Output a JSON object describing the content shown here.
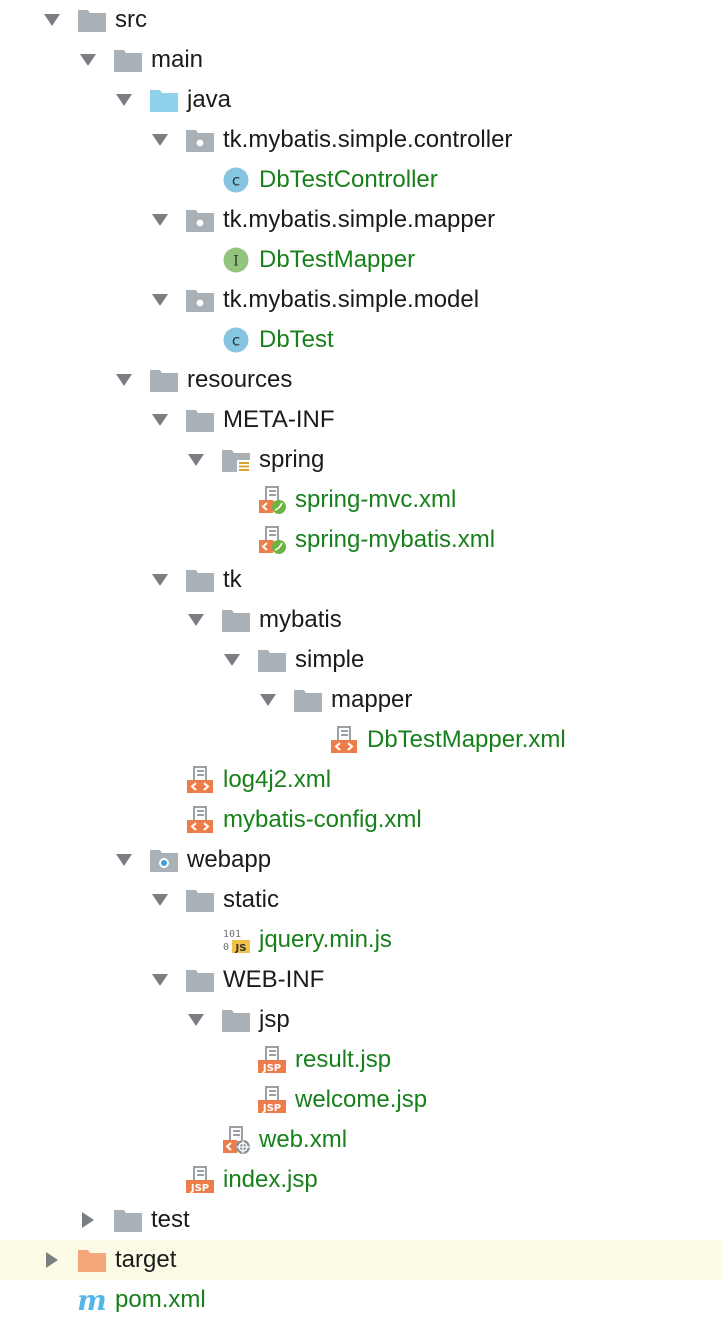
{
  "window": {
    "title": "Project tree"
  },
  "colors": {
    "folder": "#a9b0b6",
    "source_folder": "#8fd1ea",
    "excluded_folder": "#f3a77a",
    "file_text": "#18801b",
    "dir_text": "#1b1b1b",
    "selected_row_bg": "#fcfbe6",
    "xml_badge": "#ed7c4b",
    "class_icon": "#86c6e0",
    "interface_icon": "#93c47d",
    "js_badge": "#f0c24a",
    "maven_icon": "#55b5e6"
  },
  "tree": {
    "rows": [
      {
        "name": "tree-item-src",
        "label": "src",
        "level": 0,
        "arrow": "down",
        "icon": "folder-icon",
        "kind": "dir"
      },
      {
        "name": "tree-item-main",
        "label": "main",
        "level": 1,
        "arrow": "down",
        "icon": "folder-icon",
        "kind": "dir"
      },
      {
        "name": "tree-item-java",
        "label": "java",
        "level": 2,
        "arrow": "down",
        "icon": "source-folder-icon",
        "kind": "dir"
      },
      {
        "name": "tree-item-controller-package",
        "label": "tk.mybatis.simple.controller",
        "level": 3,
        "arrow": "down",
        "icon": "package-icon",
        "kind": "dir"
      },
      {
        "name": "tree-item-dbtestcontroller",
        "label": "DbTestController",
        "level": 4,
        "arrow": "none",
        "icon": "class-icon",
        "kind": "file"
      },
      {
        "name": "tree-item-mapper-package",
        "label": "tk.mybatis.simple.mapper",
        "level": 3,
        "arrow": "down",
        "icon": "package-icon",
        "kind": "dir"
      },
      {
        "name": "tree-item-dbtestmapper",
        "label": "DbTestMapper",
        "level": 4,
        "arrow": "none",
        "icon": "interface-icon",
        "kind": "file"
      },
      {
        "name": "tree-item-model-package",
        "label": "tk.mybatis.simple.model",
        "level": 3,
        "arrow": "down",
        "icon": "package-icon",
        "kind": "dir"
      },
      {
        "name": "tree-item-dbtest",
        "label": "DbTest",
        "level": 4,
        "arrow": "none",
        "icon": "class-icon",
        "kind": "file"
      },
      {
        "name": "tree-item-resources",
        "label": "resources",
        "level": 2,
        "arrow": "down",
        "icon": "folder-icon",
        "kind": "dir"
      },
      {
        "name": "tree-item-meta-inf",
        "label": "META-INF",
        "level": 3,
        "arrow": "down",
        "icon": "folder-icon",
        "kind": "dir"
      },
      {
        "name": "tree-item-spring",
        "label": "spring",
        "level": 4,
        "arrow": "down",
        "icon": "resource-folder-icon",
        "kind": "dir"
      },
      {
        "name": "tree-item-spring-mvc-xml",
        "label": "spring-mvc.xml",
        "level": 5,
        "arrow": "none",
        "icon": "spring-xml-icon",
        "kind": "file"
      },
      {
        "name": "tree-item-spring-mybatis-xml",
        "label": "spring-mybatis.xml",
        "level": 5,
        "arrow": "none",
        "icon": "spring-xml-icon",
        "kind": "file"
      },
      {
        "name": "tree-item-tk",
        "label": "tk",
        "level": 3,
        "arrow": "down",
        "icon": "folder-icon",
        "kind": "dir"
      },
      {
        "name": "tree-item-mybatis",
        "label": "mybatis",
        "level": 4,
        "arrow": "down",
        "icon": "folder-icon",
        "kind": "dir"
      },
      {
        "name": "tree-item-simple",
        "label": "simple",
        "level": 5,
        "arrow": "down",
        "icon": "folder-icon",
        "kind": "dir"
      },
      {
        "name": "tree-item-mapper-folder",
        "label": "mapper",
        "level": 6,
        "arrow": "down",
        "icon": "folder-icon",
        "kind": "dir"
      },
      {
        "name": "tree-item-dbtestmapper-xml",
        "label": "DbTestMapper.xml",
        "level": 7,
        "arrow": "none",
        "icon": "xml-file-icon",
        "kind": "file"
      },
      {
        "name": "tree-item-log4j2-xml",
        "label": "log4j2.xml",
        "level": 3,
        "arrow": "none",
        "icon": "xml-file-icon",
        "kind": "file"
      },
      {
        "name": "tree-item-mybatis-config-xml",
        "label": "mybatis-config.xml",
        "level": 3,
        "arrow": "none",
        "icon": "xml-file-icon",
        "kind": "file"
      },
      {
        "name": "tree-item-webapp",
        "label": "webapp",
        "level": 2,
        "arrow": "down",
        "icon": "web-folder-icon",
        "kind": "dir"
      },
      {
        "name": "tree-item-static",
        "label": "static",
        "level": 3,
        "arrow": "down",
        "icon": "folder-icon",
        "kind": "dir"
      },
      {
        "name": "tree-item-jquery-min-js",
        "label": "jquery.min.js",
        "level": 4,
        "arrow": "none",
        "icon": "js-file-icon",
        "kind": "file"
      },
      {
        "name": "tree-item-web-inf",
        "label": "WEB-INF",
        "level": 3,
        "arrow": "down",
        "icon": "folder-icon",
        "kind": "dir"
      },
      {
        "name": "tree-item-jsp-folder",
        "label": "jsp",
        "level": 4,
        "arrow": "down",
        "icon": "folder-icon",
        "kind": "dir"
      },
      {
        "name": "tree-item-result-jsp",
        "label": "result.jsp",
        "level": 5,
        "arrow": "none",
        "icon": "jsp-file-icon",
        "kind": "file"
      },
      {
        "name": "tree-item-welcome-jsp",
        "label": "welcome.jsp",
        "level": 5,
        "arrow": "none",
        "icon": "jsp-file-icon",
        "kind": "file"
      },
      {
        "name": "tree-item-web-xml",
        "label": "web.xml",
        "level": 4,
        "arrow": "none",
        "icon": "web-xml-icon",
        "kind": "file"
      },
      {
        "name": "tree-item-index-jsp",
        "label": "index.jsp",
        "level": 3,
        "arrow": "none",
        "icon": "jsp-file-icon",
        "kind": "file"
      },
      {
        "name": "tree-item-test",
        "label": "test",
        "level": 1,
        "arrow": "right",
        "icon": "folder-icon",
        "kind": "dir"
      },
      {
        "name": "tree-item-target",
        "label": "target",
        "level": 0,
        "arrow": "right",
        "icon": "excluded-folder-icon",
        "kind": "dir",
        "selected": true
      },
      {
        "name": "tree-item-pom-xml",
        "label": "pom.xml",
        "level": 0,
        "arrow": "none",
        "icon": "maven-icon",
        "kind": "file"
      }
    ]
  }
}
